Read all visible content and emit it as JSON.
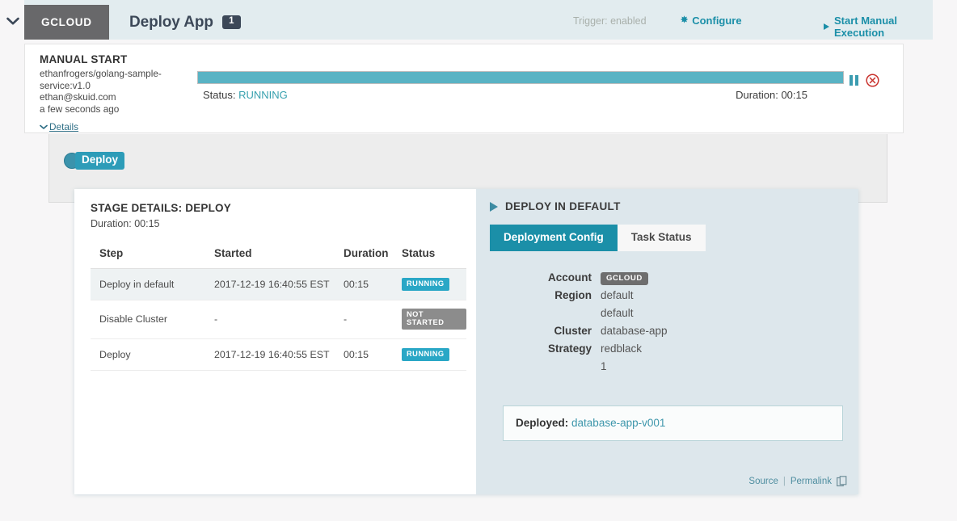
{
  "topbar": {
    "collapse_icon": "chevron-down-icon",
    "account_tab": "GCLOUD",
    "app_title": "Deploy App",
    "app_count": "1",
    "trigger_status": "Trigger: enabled",
    "configure_label": "Configure",
    "configure_icon": "gear-icon",
    "start_execution_label": "Start Manual Execution",
    "start_execution_icon": "play-icon",
    "background": "#e2ecef",
    "accent": "#1b8fa8"
  },
  "execution": {
    "title": "MANUAL START",
    "image": "ethanfrogers/golang-sample-service:v1.0",
    "user": "ethan@skuid.com",
    "time_ago": "a few seconds ago",
    "details_label": "Details",
    "details_icon": "chevron-down-icon",
    "progress_percent": 100,
    "progress_color": "#59b3c4",
    "status_prefix": "Status:",
    "status_value": "RUNNING",
    "duration_label": "Duration: 00:15",
    "pause_icon": "pause-icon",
    "stop_icon": "stop-circle-icon"
  },
  "pipeline": {
    "stage_label": "Deploy",
    "stage_color": "#2d9cb8"
  },
  "stage_details": {
    "title": "STAGE DETAILS: DEPLOY",
    "duration": "Duration: 00:15",
    "columns": [
      "Step",
      "Started",
      "Duration",
      "Status"
    ],
    "rows": [
      {
        "step": "Deploy in default",
        "started": "2017-12-19 16:40:55 EST",
        "duration": "00:15",
        "status": "RUNNING",
        "status_kind": "running"
      },
      {
        "step": "Disable Cluster",
        "started": "-",
        "duration": "-",
        "status": "NOT STARTED",
        "status_kind": "notstarted"
      },
      {
        "step": "Deploy",
        "started": "2017-12-19 16:40:55 EST",
        "duration": "00:15",
        "status": "RUNNING",
        "status_kind": "running"
      }
    ]
  },
  "deploy_panel": {
    "header": "DEPLOY IN DEFAULT",
    "header_icon": "triangle-right-icon",
    "tabs": [
      {
        "label": "Deployment Config",
        "active": true
      },
      {
        "label": "Task Status",
        "active": false
      }
    ],
    "config": [
      {
        "key": "Account",
        "value": "GCLOUD",
        "chip": true
      },
      {
        "key": "Region",
        "value": "default"
      },
      {
        "key": "",
        "value": "default"
      },
      {
        "key": "Cluster",
        "value": "database-app"
      },
      {
        "key": "Strategy",
        "value": "redblack"
      },
      {
        "key": "",
        "value": "1"
      }
    ],
    "deployed_label": "Deployed:",
    "deployed_value": "database-app-v001",
    "footer": {
      "source_label": "Source",
      "separator": "|",
      "permalink_label": "Permalink",
      "copy_icon": "clipboard-copy-icon"
    },
    "background": "#dde7ec"
  }
}
